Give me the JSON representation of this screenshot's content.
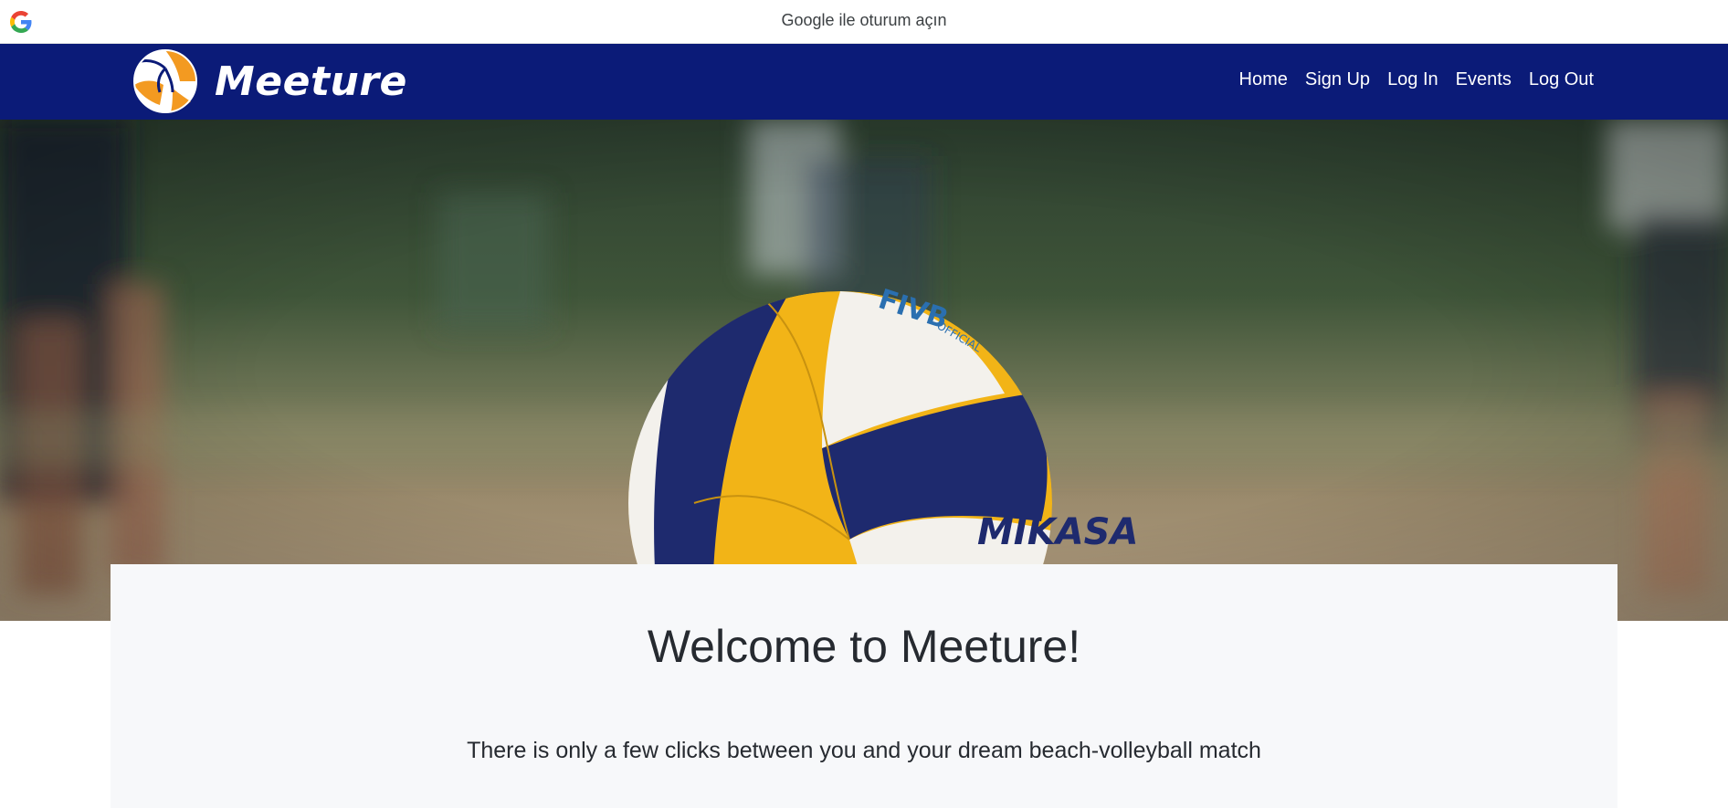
{
  "google_bar": {
    "text": "Google ile oturum açın",
    "icon": "google-g-icon"
  },
  "navbar": {
    "brand": "Meeture",
    "logo_icon": "volleyball-icon",
    "links": [
      {
        "label": "Home"
      },
      {
        "label": "Sign Up"
      },
      {
        "label": "Log In"
      },
      {
        "label": "Events"
      },
      {
        "label": "Log Out"
      }
    ]
  },
  "hero": {
    "ball_brand": "MIKASA",
    "ball_label": "FIVB",
    "ball_sublabel": "OFFICIAL"
  },
  "welcome": {
    "title": "Welcome to Meeture!",
    "subtitle": "There is only a few clicks between you and your dream beach-volleyball match"
  },
  "colors": {
    "navbar": "#0b1b78",
    "card_bg": "#f7f8fa",
    "ball_yellow": "#f2b417",
    "ball_navy": "#1e2a6e",
    "logo_orange": "#f39a21"
  }
}
